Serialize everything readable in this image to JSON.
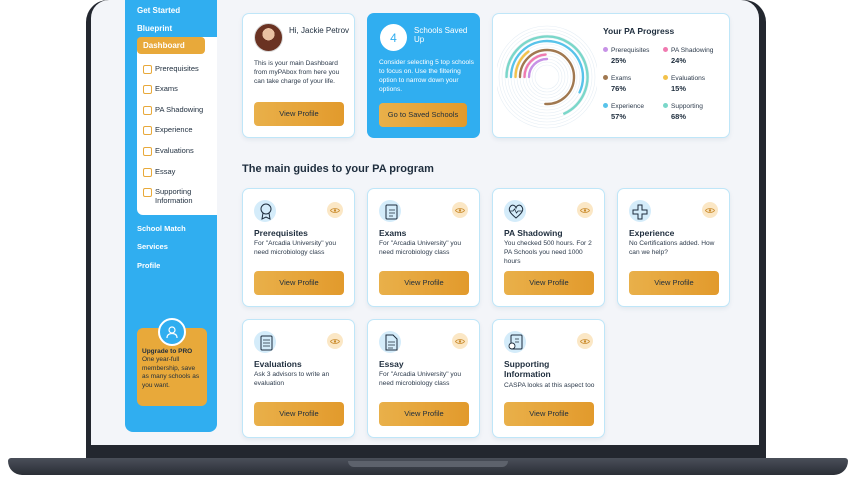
{
  "sidebar": {
    "top_items": [
      "Get Started",
      "Blueprint"
    ],
    "active_item": "Dashboard",
    "sub_items": [
      "Prerequisites",
      "Exams",
      "PA Shadowing",
      "Experience",
      "Evaluations",
      "Essay",
      "Supporting Information"
    ],
    "bottom_items": [
      "School Match",
      "Services",
      "Profile"
    ],
    "upgrade": {
      "title": "Upgrade to PRO",
      "text": "One year-full membership, save as many schools as you want."
    }
  },
  "welcome": {
    "name": "Hi, Jackie Petrov",
    "text": "This is your main Dashboard from myPAbox from here you can take charge of your life.",
    "button": "View Profile"
  },
  "schools": {
    "count": "4",
    "title": "Schools Saved Up",
    "text": "Consider selecting 5 top schools to focus on. Use the filtering option to narrow down your options.",
    "button": "Go to Saved Schools"
  },
  "progress": {
    "title": "Your PA Progress",
    "items": [
      {
        "label": "Prerequisites",
        "value": "25%",
        "color": "#c792e6"
      },
      {
        "label": "PA Shadowing",
        "value": "24%",
        "color": "#f07ab0"
      },
      {
        "label": "Exams",
        "value": "76%",
        "color": "#a07850"
      },
      {
        "label": "Evaluations",
        "value": "15%",
        "color": "#f3c24a"
      },
      {
        "label": "Experience",
        "value": "57%",
        "color": "#58c3ea"
      },
      {
        "label": "Supporting",
        "value": "68%",
        "color": "#7ad7c9"
      }
    ]
  },
  "section_title": "The main guides to your PA program",
  "guides": [
    {
      "title": "Prerequisites",
      "desc": "For \"Arcadia University\" you need microbiology class",
      "button": "View Profile",
      "icon": "ribbon-icon"
    },
    {
      "title": "Exams",
      "desc": "For \"Arcadia University\" you need microbiology class",
      "button": "View Profile",
      "icon": "clipboard-icon"
    },
    {
      "title": "PA Shadowing",
      "desc": "You checked 500 hours. For 2 PA Schools you need 1000 hours",
      "button": "View Profile",
      "icon": "heartbeat-icon"
    },
    {
      "title": "Experience",
      "desc": "No Certifications added. How can we help?",
      "button": "View Profile",
      "icon": "medical-cross-icon"
    },
    {
      "title": "Evaluations",
      "desc": "Ask 3 advisors to write an evaluation",
      "button": "View Profile",
      "icon": "checklist-icon"
    },
    {
      "title": "Essay",
      "desc": "For \"Arcadia University\" you need microbiology class",
      "button": "View Profile",
      "icon": "document-icon"
    },
    {
      "title": "Supporting Information",
      "desc": "CASPA looks at this aspect too",
      "button": "View Profile",
      "icon": "info-icon"
    }
  ]
}
